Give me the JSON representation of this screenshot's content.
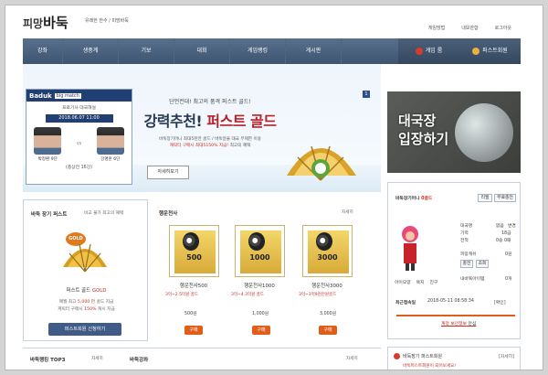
{
  "header": {
    "logo_prefix": "피망",
    "logo_main": "바둑",
    "slogan": "유쾌한 한수 / 피망바둑",
    "links": [
      "게임방법",
      "내보관함",
      "로그아웃"
    ]
  },
  "nav": {
    "items": [
      "강좌",
      "생중계",
      "기보",
      "대회",
      "게임랭킹",
      "게시판"
    ],
    "right": [
      "게임 룸",
      "퍼스트회원"
    ]
  },
  "banner": {
    "title_left": "Baduk",
    "title_right": "big match",
    "subtitle": "프로기사 대국해설",
    "date": "2018.06.07 11:00",
    "player1": "박정환 9단",
    "player2": "강명훈 6단",
    "vs": "vs",
    "footer": "(총상전 16강)",
    "line1": "단언컨대! 최고의 품격 퍼스트 골드!",
    "line2_part1": "강력추천!",
    "line2_part2": "퍼스트 골드",
    "line3": "바둑장기머니 최대5천만 골드 / 바둑알을 대국 무제한 이용",
    "line4_red": "캐릭터 구매시 최대5150% 지급!",
    "line4_tail": "최고의 혜택",
    "button": "자세히보기",
    "page": "1"
  },
  "promo": {
    "line1": "대국장",
    "line2": "입장하기"
  },
  "product": {
    "header": "바둑 장기 퍼스트",
    "tagline": "비교 불가 최고의 혜택",
    "badge": "GOLD",
    "name_prefix": "퍼스트 골드",
    "name_suffix": "GOLD",
    "desc1_prefix": "매월 최고",
    "desc1_red": "5,000 만",
    "desc1_suffix": "골드 지급",
    "desc2_prefix": "캐릭터 구매시",
    "desc2_red": "150%",
    "desc2_suffix": "캐시 지급",
    "button": "퍼스트회원 신청하기"
  },
  "items": {
    "header": "행운천사",
    "more": "자세히",
    "cards": [
      {
        "num": "500",
        "name": "행운천사500",
        "desc": "3억~2.5억원 골드",
        "price": "500원",
        "buy": "구매"
      },
      {
        "num": "1000",
        "name": "행운천사1000",
        "desc": "3억~4.3억원 골드",
        "price": "1,000원",
        "buy": "구매"
      },
      {
        "num": "3000",
        "name": "행운천사3000",
        "desc": "3억~3억9천만원골드",
        "price": "3,000원",
        "buy": "구매"
      }
    ]
  },
  "side": {
    "title": "바둑장기머니",
    "title_tag": "0골드",
    "btn1": "리필",
    "btn2": "무료충전",
    "rows": [
      {
        "k": "대국명",
        "v": "없음",
        "v2": "변경"
      },
      {
        "k": "기력",
        "v": "18급"
      },
      {
        "k": "전적",
        "v": "0승 0패"
      },
      {
        "k": "피망캐쉬",
        "v": "0원"
      },
      {
        "k": "내바둑아이템",
        "v": "0개"
      }
    ],
    "btn_charge": "충전",
    "btn_check": "조회",
    "links": [
      "아이모양",
      "목지",
      "친구"
    ],
    "last_login_label": "최근접속일",
    "last_login": "2018-05-11 08:58:34",
    "last_login_tag": "[확인]",
    "security": "계정 보안정보",
    "security_tag": "안심"
  },
  "notice": {
    "title": "바둑장기 퍼스트회원",
    "more": "[자세히]",
    "line": "바둑퍼스트회원이 되어보세요!"
  },
  "bottom": {
    "left": "바둑랭킹 TOP3",
    "mid": "바둑강좌",
    "more1": "자세히",
    "more2": "자세히"
  }
}
